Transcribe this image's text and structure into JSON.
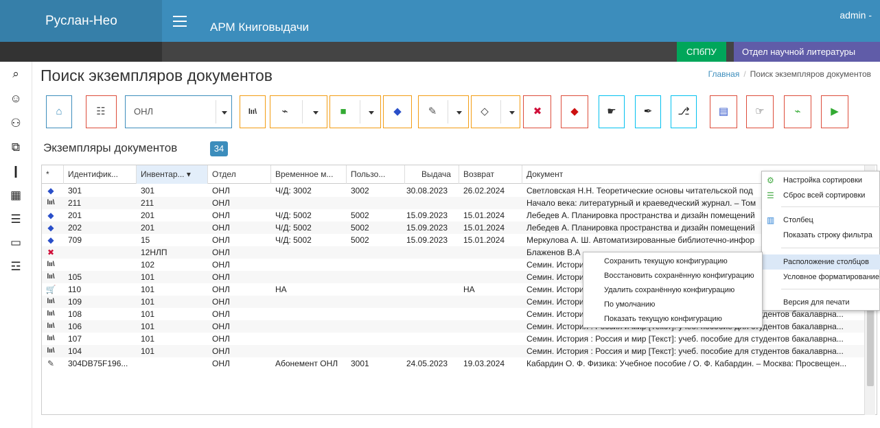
{
  "header": {
    "logo": "Руслан-Нео",
    "app_title": "АРМ Книговыдачи",
    "user": "admin -"
  },
  "subheader": {
    "org": "СПбПУ",
    "dept": "Отдел научной литературы"
  },
  "sidebar": {
    "items": [
      {
        "icon": "search-icon",
        "glyph": "🔍"
      },
      {
        "icon": "add-user-icon",
        "glyph": "👤"
      },
      {
        "icon": "users-icon",
        "glyph": "👥"
      },
      {
        "icon": "copy-icon",
        "glyph": "⧉"
      },
      {
        "icon": "document-icon",
        "glyph": "📄"
      },
      {
        "icon": "grid-icon",
        "glyph": "▦"
      },
      {
        "icon": "list-icon",
        "glyph": "☰"
      },
      {
        "icon": "calendar-icon",
        "glyph": "▭"
      },
      {
        "icon": "chat-icon",
        "glyph": "💬"
      }
    ]
  },
  "page": {
    "title": "Поиск экземпляров документов",
    "breadcrumb_home": "Главная",
    "breadcrumb_sep": "/",
    "breadcrumb_current": "Поиск экземпляров документов"
  },
  "toolbar": {
    "department_select": "ОНЛ",
    "colors": {
      "blue": "#3c8dbc",
      "red": "#dd4b39",
      "orange": "#f39c12",
      "teal": "#00c0ef",
      "green": "#00a65a"
    }
  },
  "section": {
    "title": "Экземпляры документов",
    "count": "34"
  },
  "table": {
    "columns": [
      "*",
      "Идентифик...",
      "Инвентар...",
      "Отдел",
      "Временное м...",
      "Пользо...",
      "Выдача",
      "Возврат",
      "Документ"
    ],
    "sorted_indicator": "▾",
    "rows": [
      {
        "icon": "book-icon",
        "glyph": "◆",
        "color": "#2a4fc9",
        "id": "301",
        "inv": "301",
        "dept": "ОНЛ",
        "temp": "Ч/Д: 3002",
        "user": "3002",
        "issue": "30.08.2023",
        "ret": "26.02.2024",
        "doc": "Светловская Н.Н. Теоретические основы читательской под"
      },
      {
        "icon": "books-icon",
        "glyph": "lıı\\",
        "color": "#222",
        "id": "211",
        "inv": "211",
        "dept": "ОНЛ",
        "temp": "",
        "user": "",
        "issue": "",
        "ret": "",
        "doc": "Начало века: литературный и краеведческий журнал. – Том"
      },
      {
        "icon": "book-icon",
        "glyph": "◆",
        "color": "#2a4fc9",
        "id": "201",
        "inv": "201",
        "dept": "ОНЛ",
        "temp": "Ч/Д: 5002",
        "user": "5002",
        "issue": "15.09.2023",
        "ret": "15.01.2024",
        "doc": "Лебедев А. Планировка пространства и дизайн помещений"
      },
      {
        "icon": "book-icon",
        "glyph": "◆",
        "color": "#2a4fc9",
        "id": "202",
        "inv": "201",
        "dept": "ОНЛ",
        "temp": "Ч/Д: 5002",
        "user": "5002",
        "issue": "15.09.2023",
        "ret": "15.01.2024",
        "doc": "Лебедев А. Планировка пространства и дизайн помещений"
      },
      {
        "icon": "book-icon",
        "glyph": "◆",
        "color": "#2a4fc9",
        "id": "709",
        "inv": "15",
        "dept": "ОНЛ",
        "temp": "Ч/Д: 5002",
        "user": "5002",
        "issue": "15.09.2023",
        "ret": "15.01.2024",
        "doc": "Меркулова А. Ш. Автоматизированные библиотечно-инфор"
      },
      {
        "icon": "lost-icon",
        "glyph": "✖",
        "color": "#d0103a",
        "id": "",
        "inv": "12НЛП",
        "dept": "ОНЛ",
        "temp": "",
        "user": "",
        "issue": "",
        "ret": "",
        "doc": "Блаженов В.А"
      },
      {
        "icon": "books-icon",
        "glyph": "lıı\\",
        "color": "#222",
        "id": "",
        "inv": "102",
        "dept": "ОНЛ",
        "temp": "",
        "user": "",
        "issue": "",
        "ret": "",
        "doc": "Семин. Истори"
      },
      {
        "icon": "books-icon",
        "glyph": "lıı\\",
        "color": "#222",
        "id": "105",
        "inv": "101",
        "dept": "ОНЛ",
        "temp": "",
        "user": "",
        "issue": "",
        "ret": "",
        "doc": "Семин. Истори"
      },
      {
        "icon": "cart-icon",
        "glyph": "🛒",
        "color": "#222",
        "id": "110",
        "inv": "101",
        "dept": "ОНЛ",
        "temp": "НА",
        "user": "",
        "issue": "",
        "ret": "НА",
        "doc": "Семин. Истори"
      },
      {
        "icon": "books-icon",
        "glyph": "lıı\\",
        "color": "#222",
        "id": "109",
        "inv": "101",
        "dept": "ОНЛ",
        "temp": "",
        "user": "",
        "issue": "",
        "ret": "",
        "doc": "Семин. Истори                                         тудентов бакалаврна..."
      },
      {
        "icon": "books-icon",
        "glyph": "lıı\\",
        "color": "#222",
        "id": "108",
        "inv": "101",
        "dept": "ОНЛ",
        "temp": "",
        "user": "",
        "issue": "",
        "ret": "",
        "doc": "Семин. История : Россия и мир [Текст]: учеб. пособие для студентов бакалаврна..."
      },
      {
        "icon": "books-icon",
        "glyph": "lıı\\",
        "color": "#222",
        "id": "106",
        "inv": "101",
        "dept": "ОНЛ",
        "temp": "",
        "user": "",
        "issue": "",
        "ret": "",
        "doc": "Семин. История : Россия и мир [Текст]: учеб. пособие для студентов бакалаврна..."
      },
      {
        "icon": "books-icon",
        "glyph": "lıı\\",
        "color": "#222",
        "id": "107",
        "inv": "101",
        "dept": "ОНЛ",
        "temp": "",
        "user": "",
        "issue": "",
        "ret": "",
        "doc": "Семин. История : Россия и мир [Текст]: учеб. пособие для студентов бакалаврна..."
      },
      {
        "icon": "books-icon",
        "glyph": "lıı\\",
        "color": "#222",
        "id": "104",
        "inv": "101",
        "dept": "ОНЛ",
        "temp": "",
        "user": "",
        "issue": "",
        "ret": "",
        "doc": "Семин. История : Россия и мир [Текст]: учеб. пособие для студентов бакалаврна..."
      },
      {
        "icon": "pen-book-icon",
        "glyph": "✎",
        "color": "#444",
        "id": "304DB75F196...",
        "inv": "",
        "dept": "ОНЛ",
        "temp": "Абонемент ОНЛ",
        "user": "3001",
        "issue": "24.05.2023",
        "ret": "19.03.2024",
        "doc": "Кабардин О. Ф. Физика: Учебное пособие / О. Ф. Кабардин. – Москва: Просвещен..."
      }
    ]
  },
  "context_menu": {
    "items": [
      {
        "label": "Настройка сортировки",
        "icon": "sort-settings-icon"
      },
      {
        "label": "Сброс всей сортировки",
        "icon": "sort-reset-icon"
      },
      {
        "label": "Столбец",
        "icon": "column-icon"
      },
      {
        "label": "Показать строку фильтра",
        "icon": ""
      },
      {
        "label": "Расположение столбцов",
        "icon": ""
      },
      {
        "label": "Условное форматирование",
        "icon": ""
      },
      {
        "label": "Версия для печати",
        "icon": ""
      }
    ]
  },
  "submenu": {
    "items": [
      "Сохранить текущую конфигурацию",
      "Восстановить сохранённую конфигурацию",
      "Удалить сохранённую конфигурацию",
      "По умолчанию",
      "Показать текущую конфигурацию"
    ]
  }
}
